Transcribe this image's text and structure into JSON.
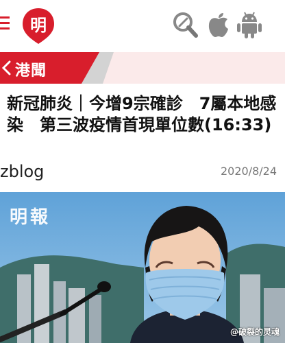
{
  "header": {
    "logo_text": "明",
    "icons": [
      "search-icon",
      "apple-icon",
      "android-icon"
    ],
    "brand_color": "#d81e2c"
  },
  "section": {
    "label": "港聞"
  },
  "article": {
    "title": "新冠肺炎｜今增9宗確診　7屬本地感染　第三波疫情首現單位數(16:33)",
    "author": "zblog",
    "date": "2020/8/24"
  },
  "photo": {
    "watermark": "明報",
    "credit": "@破裂的灵魂"
  }
}
